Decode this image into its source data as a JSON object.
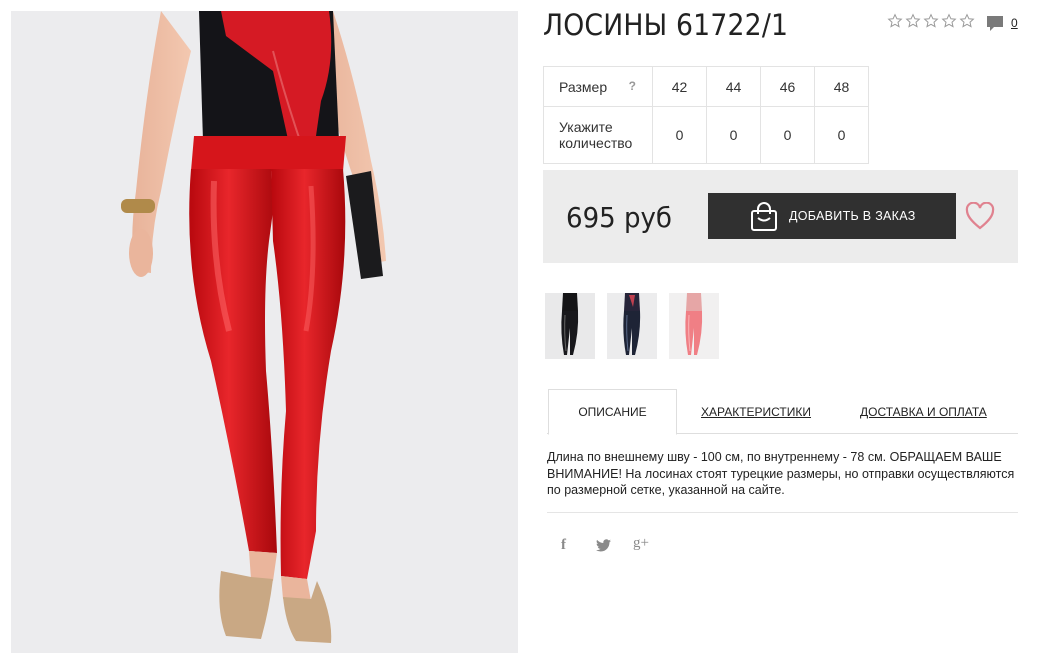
{
  "product": {
    "title": "ЛОСИНЫ 61722/1",
    "rating_icon": "star-outline-icon",
    "comment_count": "0"
  },
  "sizes_table": {
    "size_label": "Размер",
    "help_label": "?",
    "quantity_label_line1": "Укажите",
    "quantity_label_line2": "количество",
    "sizes": [
      "42",
      "44",
      "46",
      "48"
    ],
    "quantities": [
      "0",
      "0",
      "0",
      "0"
    ]
  },
  "purchase": {
    "price": "695 руб",
    "add_button_label": "ДОБАВИТЬ В ЗАКАЗ",
    "button_icon": "shopping-bag-icon",
    "wishlist_icon": "heart-icon",
    "accent_color": "#e0828f"
  },
  "tabs": {
    "description": "ОПИСАНИЕ",
    "characteristics": "ХАРАКТЕРИСТИКИ",
    "delivery": "ДОСТАВКА И ОПЛАТА"
  },
  "description_text": "Длина по внешнему шву - 100 см, по внутреннему - 78 см. ОБРАЩАЕМ ВАШЕ ВНИМАНИЕ! На лосинах стоят турецкие размеры, но отправки осуществляются по размерной сетке, указанной на сайте.",
  "social": {
    "facebook": "f",
    "twitter": "🐦",
    "googleplus": "g+"
  },
  "colors": {
    "product_red": "#dd1f24",
    "button_dark": "#303030",
    "price_bg": "#ececec"
  }
}
